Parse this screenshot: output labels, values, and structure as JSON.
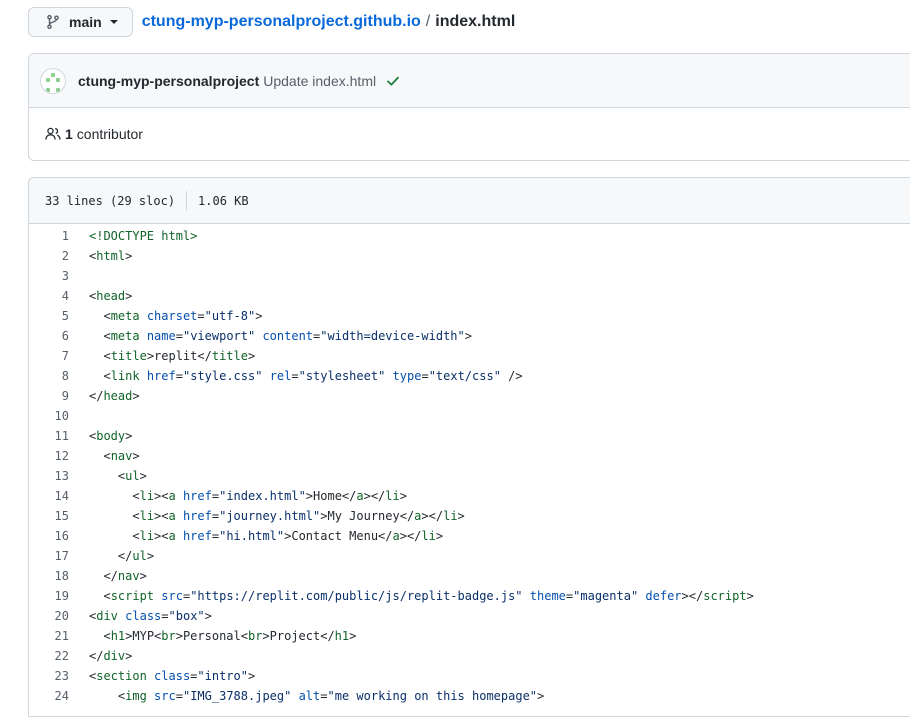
{
  "branch": {
    "label": "main"
  },
  "breadcrumb": {
    "repo": "ctung-myp-personalproject.github.io",
    "separator": "/",
    "file": "index.html"
  },
  "commit": {
    "author": "ctung-myp-personalproject",
    "message": "Update index.html",
    "status_icon": "check-icon"
  },
  "contributors": {
    "count": "1",
    "label": "contributor"
  },
  "file_info": {
    "lines": "33 lines (29 sloc)",
    "size": "1.06 KB"
  },
  "colors": {
    "link": "#0969da",
    "tag": "#116329",
    "attribute": "#0550ae",
    "string": "#0a3069",
    "success": "#1a7f37"
  },
  "code_lines": [
    {
      "n": "1",
      "tokens": [
        [
          "t",
          "<!DOCTYPE html>"
        ]
      ]
    },
    {
      "n": "2",
      "tokens": [
        [
          "p",
          "<"
        ],
        [
          "t",
          "html"
        ],
        [
          "p",
          ">"
        ]
      ]
    },
    {
      "n": "3",
      "tokens": []
    },
    {
      "n": "4",
      "tokens": [
        [
          "p",
          "<"
        ],
        [
          "t",
          "head"
        ],
        [
          "p",
          ">"
        ]
      ]
    },
    {
      "n": "5",
      "tokens": [
        [
          "p",
          "  <"
        ],
        [
          "t",
          "meta"
        ],
        [
          "p",
          " "
        ],
        [
          "a",
          "charset"
        ],
        [
          "p",
          "="
        ],
        [
          "s",
          "\"utf-8\""
        ],
        [
          "p",
          ">"
        ]
      ]
    },
    {
      "n": "6",
      "tokens": [
        [
          "p",
          "  <"
        ],
        [
          "t",
          "meta"
        ],
        [
          "p",
          " "
        ],
        [
          "a",
          "name"
        ],
        [
          "p",
          "="
        ],
        [
          "s",
          "\"viewport\""
        ],
        [
          "p",
          " "
        ],
        [
          "a",
          "content"
        ],
        [
          "p",
          "="
        ],
        [
          "s",
          "\"width=device-width\""
        ],
        [
          "p",
          ">"
        ]
      ]
    },
    {
      "n": "7",
      "tokens": [
        [
          "p",
          "  <"
        ],
        [
          "t",
          "title"
        ],
        [
          "p",
          ">replit</"
        ],
        [
          "t",
          "title"
        ],
        [
          "p",
          ">"
        ]
      ]
    },
    {
      "n": "8",
      "tokens": [
        [
          "p",
          "  <"
        ],
        [
          "t",
          "link"
        ],
        [
          "p",
          " "
        ],
        [
          "a",
          "href"
        ],
        [
          "p",
          "="
        ],
        [
          "s",
          "\"style.css\""
        ],
        [
          "p",
          " "
        ],
        [
          "a",
          "rel"
        ],
        [
          "p",
          "="
        ],
        [
          "s",
          "\"stylesheet\""
        ],
        [
          "p",
          " "
        ],
        [
          "a",
          "type"
        ],
        [
          "p",
          "="
        ],
        [
          "s",
          "\"text/css\""
        ],
        [
          "p",
          " />"
        ]
      ]
    },
    {
      "n": "9",
      "tokens": [
        [
          "p",
          "</"
        ],
        [
          "t",
          "head"
        ],
        [
          "p",
          ">"
        ]
      ]
    },
    {
      "n": "10",
      "tokens": []
    },
    {
      "n": "11",
      "tokens": [
        [
          "p",
          "<"
        ],
        [
          "t",
          "body"
        ],
        [
          "p",
          ">"
        ]
      ]
    },
    {
      "n": "12",
      "tokens": [
        [
          "p",
          "  <"
        ],
        [
          "t",
          "nav"
        ],
        [
          "p",
          ">"
        ]
      ]
    },
    {
      "n": "13",
      "tokens": [
        [
          "p",
          "    <"
        ],
        [
          "t",
          "ul"
        ],
        [
          "p",
          ">"
        ]
      ]
    },
    {
      "n": "14",
      "tokens": [
        [
          "p",
          "      <"
        ],
        [
          "t",
          "li"
        ],
        [
          "p",
          "><"
        ],
        [
          "t",
          "a"
        ],
        [
          "p",
          " "
        ],
        [
          "a",
          "href"
        ],
        [
          "p",
          "="
        ],
        [
          "s",
          "\"index.html\""
        ],
        [
          "p",
          ">Home</"
        ],
        [
          "t",
          "a"
        ],
        [
          "p",
          "></"
        ],
        [
          "t",
          "li"
        ],
        [
          "p",
          ">"
        ]
      ]
    },
    {
      "n": "15",
      "tokens": [
        [
          "p",
          "      <"
        ],
        [
          "t",
          "li"
        ],
        [
          "p",
          "><"
        ],
        [
          "t",
          "a"
        ],
        [
          "p",
          " "
        ],
        [
          "a",
          "href"
        ],
        [
          "p",
          "="
        ],
        [
          "s",
          "\"journey.html\""
        ],
        [
          "p",
          ">My Journey</"
        ],
        [
          "t",
          "a"
        ],
        [
          "p",
          "></"
        ],
        [
          "t",
          "li"
        ],
        [
          "p",
          ">"
        ]
      ]
    },
    {
      "n": "16",
      "tokens": [
        [
          "p",
          "      <"
        ],
        [
          "t",
          "li"
        ],
        [
          "p",
          "><"
        ],
        [
          "t",
          "a"
        ],
        [
          "p",
          " "
        ],
        [
          "a",
          "href"
        ],
        [
          "p",
          "="
        ],
        [
          "s",
          "\"hi.html\""
        ],
        [
          "p",
          ">Contact Menu</"
        ],
        [
          "t",
          "a"
        ],
        [
          "p",
          "></"
        ],
        [
          "t",
          "li"
        ],
        [
          "p",
          ">"
        ]
      ]
    },
    {
      "n": "17",
      "tokens": [
        [
          "p",
          "    </"
        ],
        [
          "t",
          "ul"
        ],
        [
          "p",
          ">"
        ]
      ]
    },
    {
      "n": "18",
      "tokens": [
        [
          "p",
          "  </"
        ],
        [
          "t",
          "nav"
        ],
        [
          "p",
          ">"
        ]
      ]
    },
    {
      "n": "19",
      "tokens": [
        [
          "p",
          "  <"
        ],
        [
          "t",
          "script"
        ],
        [
          "p",
          " "
        ],
        [
          "a",
          "src"
        ],
        [
          "p",
          "="
        ],
        [
          "s",
          "\"https://replit.com/public/js/replit-badge.js\""
        ],
        [
          "p",
          " "
        ],
        [
          "a",
          "theme"
        ],
        [
          "p",
          "="
        ],
        [
          "s",
          "\"magenta\""
        ],
        [
          "p",
          " "
        ],
        [
          "a",
          "defer"
        ],
        [
          "p",
          "></"
        ],
        [
          "t",
          "script"
        ],
        [
          "p",
          ">"
        ]
      ]
    },
    {
      "n": "20",
      "tokens": [
        [
          "p",
          "<"
        ],
        [
          "t",
          "div"
        ],
        [
          "p",
          " "
        ],
        [
          "a",
          "class"
        ],
        [
          "p",
          "="
        ],
        [
          "s",
          "\"box\""
        ],
        [
          "p",
          ">"
        ]
      ]
    },
    {
      "n": "21",
      "tokens": [
        [
          "p",
          "  <"
        ],
        [
          "t",
          "h1"
        ],
        [
          "p",
          ">MYP<"
        ],
        [
          "t",
          "br"
        ],
        [
          "p",
          ">Personal<"
        ],
        [
          "t",
          "br"
        ],
        [
          "p",
          ">Project</"
        ],
        [
          "t",
          "h1"
        ],
        [
          "p",
          ">"
        ]
      ]
    },
    {
      "n": "22",
      "tokens": [
        [
          "p",
          "</"
        ],
        [
          "t",
          "div"
        ],
        [
          "p",
          ">"
        ]
      ]
    },
    {
      "n": "23",
      "tokens": [
        [
          "p",
          "<"
        ],
        [
          "t",
          "section"
        ],
        [
          "p",
          " "
        ],
        [
          "a",
          "class"
        ],
        [
          "p",
          "="
        ],
        [
          "s",
          "\"intro\""
        ],
        [
          "p",
          ">"
        ]
      ]
    },
    {
      "n": "24",
      "tokens": [
        [
          "p",
          "    <"
        ],
        [
          "t",
          "img"
        ],
        [
          "p",
          " "
        ],
        [
          "a",
          "src"
        ],
        [
          "p",
          "="
        ],
        [
          "s",
          "\"IMG_3788.jpeg\""
        ],
        [
          "p",
          " "
        ],
        [
          "a",
          "alt"
        ],
        [
          "p",
          "="
        ],
        [
          "s",
          "\"me working on this homepage\""
        ],
        [
          "p",
          ">"
        ]
      ]
    }
  ]
}
